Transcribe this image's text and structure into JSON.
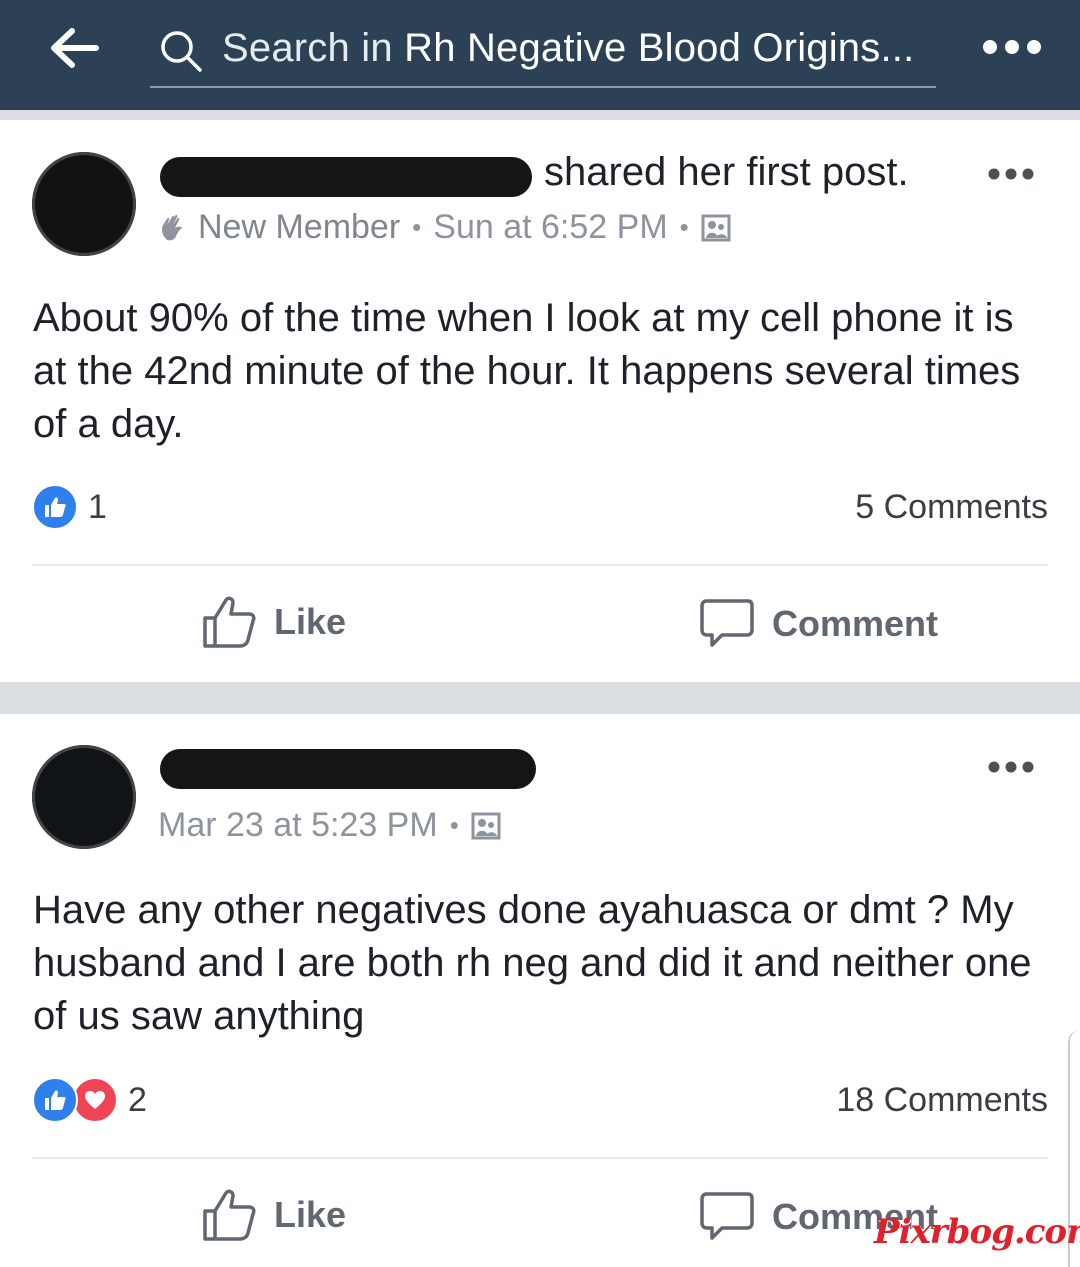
{
  "header": {
    "search_prefix": "Search in ",
    "search_group": "Rh Negative Blood Origins..."
  },
  "posts": [
    {
      "shared_text": "shared her first post.",
      "badge": "New Member",
      "time": "Sun at 6:52 PM",
      "body": "About 90% of the time when I look at my cell phone it is at the 42nd minute of the hour. It happens several times of a day.",
      "reaction_count": "1",
      "comments": "5 Comments",
      "like_label": "Like",
      "comment_label": "Comment"
    },
    {
      "time": "Mar 23 at 5:23 PM",
      "body": "Have any other negatives done ayahuasca or dmt ? My husband and I are both rh neg and did it and neither one of us saw anything",
      "reaction_count": "2",
      "comments": "18 Comments",
      "like_label": "Like",
      "comment_label": "Comment"
    }
  ],
  "watermark": "Pixrbog.com",
  "colors": {
    "topbar": "#2c4156",
    "like_blue": "#2f80ed",
    "love_red": "#ef4356"
  }
}
